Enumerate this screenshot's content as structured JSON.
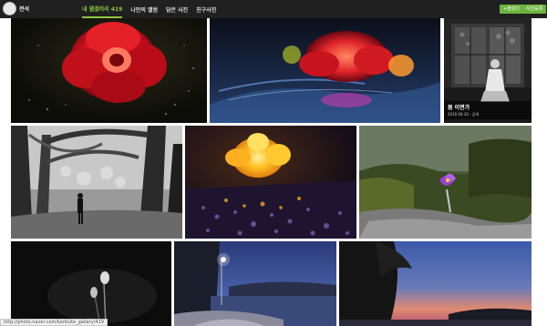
{
  "header": {
    "username": "전석",
    "nav": [
      {
        "label": "내 웹갤러리 419"
      },
      {
        "label": "나만의 앨범"
      },
      {
        "label": "담은 사진"
      },
      {
        "label": "친구사진"
      }
    ],
    "upload_label": "+올린다",
    "register_label": "사진등록"
  },
  "gallery": {
    "photos": [
      {
        "subject": "red camellia flower glowing on dark ground"
      },
      {
        "subject": "red flower glowing with blue light streaks"
      },
      {
        "subject": "woman in hanbok seated by a window",
        "title": "봄 이면가",
        "meta": "2016·04·30 · 공개"
      },
      {
        "subject": "black and white trees with a standing figure"
      },
      {
        "subject": "yellow glowing flower over purple water droplets"
      },
      {
        "subject": "purple pasque flower among mossy rocks"
      },
      {
        "subject": "black and white pasque flower buds"
      },
      {
        "subject": "coastal road with a street lamp at dusk"
      },
      {
        "subject": "silhouetted pine trees against a sunset sea"
      }
    ]
  },
  "statusbar": {
    "text": "http://photo.naver.com/kerbsite_gallery/419"
  },
  "colors": {
    "accent": "#8cc63f",
    "button": "#6db33f",
    "topbar": "#202020"
  }
}
